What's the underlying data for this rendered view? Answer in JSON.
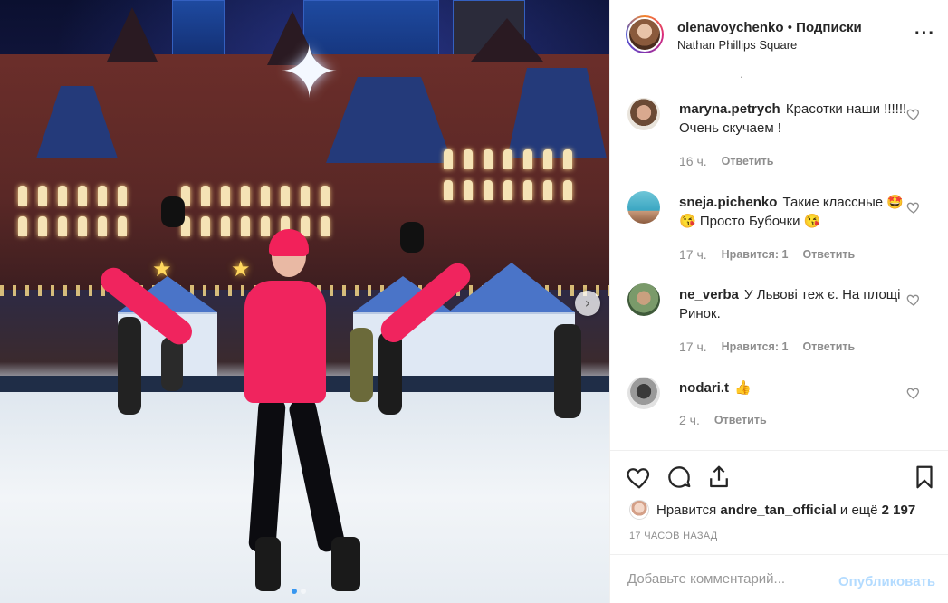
{
  "post": {
    "username": "olenavoychenko",
    "separator": "•",
    "follow_label": "Подписки",
    "location": "Nathan Phillips Square",
    "more_icon": "more-horizontal-icon"
  },
  "photo": {
    "next_icon": "chevron-right-icon",
    "next_glyph": "›",
    "carousel": {
      "total": 2,
      "active": 1
    }
  },
  "comments": [
    {
      "username": "maryna.petrych",
      "text": "Красотки наши !!!!!! Очень скучаем !",
      "time": "16 ч.",
      "likes": "",
      "reply": "Ответить"
    },
    {
      "username": "sneja.pichenko",
      "text": "Такие классные 🤩 😘 Просто Бубочки 😘",
      "time": "17 ч.",
      "likes": "Нравится: 1",
      "reply": "Ответить"
    },
    {
      "username": "ne_verba",
      "text": "У Львові теж є. На площі Ринок.",
      "time": "17 ч.",
      "likes": "Нравится: 1",
      "reply": "Ответить"
    },
    {
      "username": "nodari.t",
      "text": "👍",
      "time": "2 ч.",
      "likes": "",
      "reply": "Ответить"
    }
  ],
  "actions": {
    "icons": [
      "heart-icon",
      "comment-icon",
      "share-icon",
      "bookmark-icon"
    ],
    "likes_prefix": "Нравится",
    "likes_user": "andre_tan_official",
    "likes_middle": "и ещё",
    "likes_count": "2 197",
    "timestamp": "17 ЧАСОВ НАЗАД"
  },
  "add_comment": {
    "placeholder": "Добавьте комментарий...",
    "post_label": "Опубликовать"
  },
  "colors": {
    "accent": "#3897f0",
    "post_disabled": "#b3dbff",
    "secondary_text": "#8e8e8e",
    "jacket": "#f0245e"
  }
}
